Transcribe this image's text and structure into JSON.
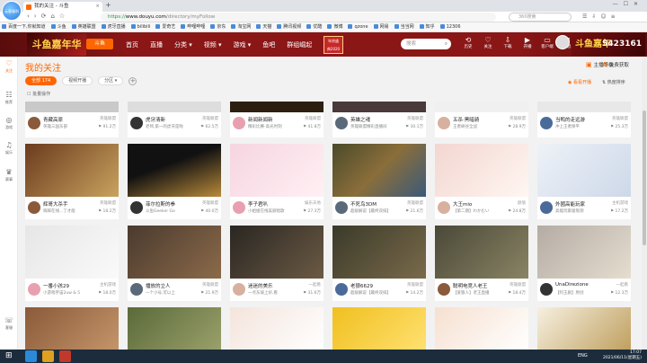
{
  "browser": {
    "badge": "云客福利",
    "tab_title": "我的关注 - 斗鱼",
    "url_scheme": "https://",
    "url_host": "www.douyu.com",
    "url_path": "/directory/myFollow",
    "search_placeholder": "360搜索"
  },
  "bookmarks": [
    "百度一下,你就知道",
    "斗鱼",
    "英雄联盟",
    "虎牙直播",
    "bilibili",
    "爱奇艺",
    "哔哩哔哩",
    "京东",
    "淘宝网",
    "天猫",
    "腾讯视频",
    "优酷",
    "微博",
    "qzone",
    "网易",
    "当当网",
    "知乎",
    "12306"
  ],
  "header": {
    "banner_left": "斗鱼嘉年华",
    "logo": "斗鱼",
    "nav": [
      "首页",
      "直播",
      "分类 ▾",
      "视频 ▾",
      "游戏 ▾",
      "鱼吧",
      "群组崛起"
    ],
    "year_badge_line1": "年终盛",
    "year_badge_line2": "典2020",
    "search_placeholder": "搜索",
    "icons": [
      {
        "label": "历史",
        "icon": "history-icon",
        "glyph": "⟲"
      },
      {
        "label": "关注",
        "icon": "follow-icon",
        "glyph": "♡"
      },
      {
        "label": "下载",
        "icon": "download-icon",
        "glyph": "⇩"
      },
      {
        "label": "开播",
        "icon": "broadcast-icon",
        "glyph": "▶"
      },
      {
        "label": "客户端",
        "icon": "client-icon",
        "glyph": "▭"
      },
      {
        "label": "消息",
        "icon": "message-icon",
        "glyph": "✉"
      }
    ],
    "banner_right": "斗鱼嘉年",
    "banner_right_num": "5423161"
  },
  "sidebar": [
    {
      "label": "关注",
      "icon": "heart-icon",
      "glyph": "♡"
    },
    {
      "label": "推荐",
      "icon": "recommend-icon",
      "glyph": "☷"
    },
    {
      "label": "游戏",
      "icon": "game-icon",
      "glyph": "◎"
    },
    {
      "label": "娱乐",
      "icon": "entertainment-icon",
      "glyph": "♫"
    },
    {
      "label": "赛事",
      "icon": "trophy-icon",
      "glyph": "♛"
    },
    {
      "label": "客服",
      "icon": "service-icon",
      "glyph": "☏"
    }
  ],
  "main": {
    "title": "我的关注",
    "top_right_1": "主播等级",
    "top_right_2": "免费获取",
    "filters": [
      "全部 174",
      "视频开播",
      "分区 ▾"
    ],
    "batch_label": "批量操作",
    "link_1": "看看开播",
    "link_2": "热度排序"
  },
  "top_row": [
    {
      "title": "青藏高原",
      "cat": "英雄联盟",
      "name": "英雄三国东部",
      "heat": "91.2万"
    },
    {
      "title": "虎牙清新",
      "cat": "英雄联盟",
      "name": "老师,第一的虎牙是啦",
      "heat": "62.5万"
    },
    {
      "title": "新闻新闻新",
      "cat": "英雄联盟",
      "name": "精彩比赛-高光时刻",
      "heat": "41.8万"
    },
    {
      "title": "英雄之魂",
      "cat": "英雄联盟",
      "name": "英雄联盟精彩直播间",
      "heat": "30.1万"
    },
    {
      "title": "五杀·黑暗骑",
      "cat": "英雄联盟",
      "name": "王者峡谷全战",
      "heat": "28.9万"
    },
    {
      "title": "当鸭的走远游",
      "cat": "英雄联盟",
      "name": "冲上王者保平",
      "heat": "25.3万"
    }
  ],
  "rows": [
    [
      {
        "title": "辉哥大杀手",
        "cat": "英雄联盟",
        "name": "辉辉在线...了才能",
        "heat": "18.2万"
      },
      {
        "title": "菲尔拉斯的拳",
        "cat": "英雄联盟",
        "name": "斗鱼Geeker Go",
        "heat": "40.0万"
      },
      {
        "title": "李子君叭",
        "cat": "娱乐天地",
        "name": "小姐姐在线美丽唱歌",
        "heat": "27.3万"
      },
      {
        "title": "不死鸟3DM",
        "cat": "英雄联盟",
        "name": "超级解说【最终双排】",
        "heat": "21.6万"
      },
      {
        "title": "大王mio",
        "cat": "颜值",
        "name": "【第二期】わかむい",
        "heat": "24.8万"
      },
      {
        "title": "外國高能玩家",
        "cat": "主机游戏",
        "name": "高能玩家极限测",
        "heat": "17.2万"
      }
    ],
    [
      {
        "title": "一番小孩29",
        "cat": "主机游戏",
        "name": "小游戏宇宙2uw & 5",
        "heat": "18.0万"
      },
      {
        "title": "播放的立人",
        "cat": "英雄联盟",
        "name": "一个小号,可以上",
        "heat": "21.9万"
      },
      {
        "title": "迷迷的美乐",
        "cat": "一起看",
        "name": "一点东坡上好,看",
        "heat": "31.6万"
      },
      {
        "title": "老狼6629",
        "cat": "英雄联盟",
        "name": "超级解说【最终双排】",
        "heat": "14.2万"
      },
      {
        "title": "聪明电竞人老王",
        "cat": "英雄联盟",
        "name": "【爱狼人】老王直播",
        "heat": "18.4万"
      },
      {
        "title": "UnaDirezione",
        "cat": "一起看",
        "name": "【阿王剧】原创",
        "heat": "12.3万"
      }
    ]
  ],
  "taskbar": {
    "lang": "ENG",
    "time": "17:07",
    "date": "2021/06/11(星期五)"
  }
}
